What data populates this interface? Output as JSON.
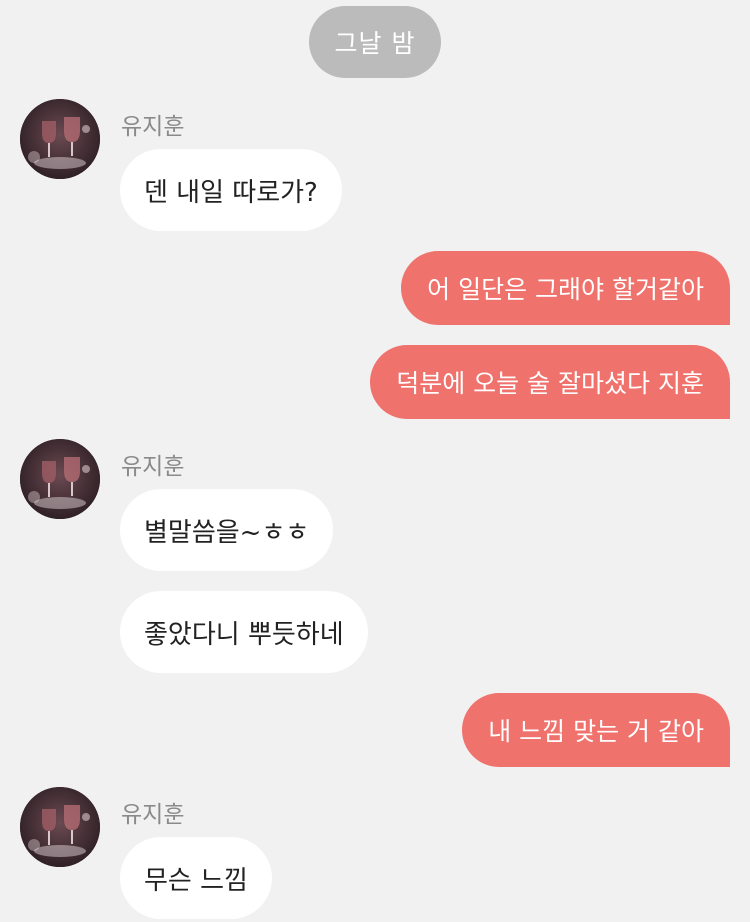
{
  "chat": {
    "date_label": "그날 밤",
    "messages": [
      {
        "from": "in",
        "sender": "유지훈",
        "text": "덴 내일 따로가?"
      },
      {
        "from": "out",
        "text": "어 일단은 그래야 할거같아"
      },
      {
        "from": "out",
        "text": "덕분에 오늘 술 잘마셨다 지훈"
      },
      {
        "from": "in",
        "sender": "유지훈",
        "text": "별말씀을~ㅎㅎ"
      },
      {
        "from": "in",
        "text": "좋았다니 뿌듯하네"
      },
      {
        "from": "out",
        "text": "내 느낌 맞는 거 같아"
      },
      {
        "from": "in",
        "sender": "유지훈",
        "text": "무슨 느낌"
      }
    ]
  },
  "colors": {
    "background": "#f2f1f1",
    "outgoing_bubble": "#ef726d",
    "incoming_bubble": "#ffffff",
    "date_pill": "#bbbbbb"
  },
  "icons": {
    "avatar": "profile-photo-wine-glasses"
  }
}
